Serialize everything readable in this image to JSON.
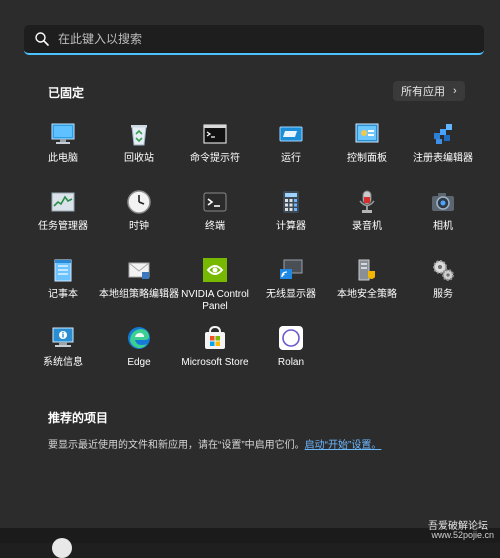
{
  "search": {
    "placeholder": "在此键入以搜索"
  },
  "pinned": {
    "title": "已固定",
    "all_apps_label": "所有应用",
    "all_apps_chevron": "›",
    "apps": [
      {
        "label": "此电脑",
        "icon": "computer-icon"
      },
      {
        "label": "回收站",
        "icon": "recycle-bin-icon"
      },
      {
        "label": "命令提示符",
        "icon": "command-prompt-icon"
      },
      {
        "label": "运行",
        "icon": "run-icon"
      },
      {
        "label": "控制面板",
        "icon": "control-panel-icon"
      },
      {
        "label": "注册表编辑器",
        "icon": "registry-editor-icon"
      },
      {
        "label": "任务管理器",
        "icon": "task-manager-icon"
      },
      {
        "label": "时钟",
        "icon": "clock-icon"
      },
      {
        "label": "终端",
        "icon": "terminal-icon"
      },
      {
        "label": "计算器",
        "icon": "calculator-icon"
      },
      {
        "label": "录音机",
        "icon": "sound-recorder-icon"
      },
      {
        "label": "相机",
        "icon": "camera-icon"
      },
      {
        "label": "记事本",
        "icon": "notepad-icon"
      },
      {
        "label": "本地组策略编辑器",
        "icon": "group-policy-icon"
      },
      {
        "label": "NVIDIA Control Panel",
        "icon": "nvidia-icon"
      },
      {
        "label": "无线显示器",
        "icon": "wireless-display-icon"
      },
      {
        "label": "本地安全策略",
        "icon": "security-policy-icon"
      },
      {
        "label": "服务",
        "icon": "services-icon"
      },
      {
        "label": "系统信息",
        "icon": "system-info-icon"
      },
      {
        "label": "Edge",
        "icon": "edge-icon"
      },
      {
        "label": "Microsoft Store",
        "icon": "store-icon"
      },
      {
        "label": "Rolan",
        "icon": "rolan-icon"
      }
    ]
  },
  "recommended": {
    "title": "推荐的项目",
    "text": "要显示最近使用的文件和新应用，请在“设置”中启用它们。",
    "link": "启动“开始”设置。"
  },
  "watermark": {
    "line1": "吾爱破解论坛",
    "line2": "www.52pojie.cn"
  }
}
